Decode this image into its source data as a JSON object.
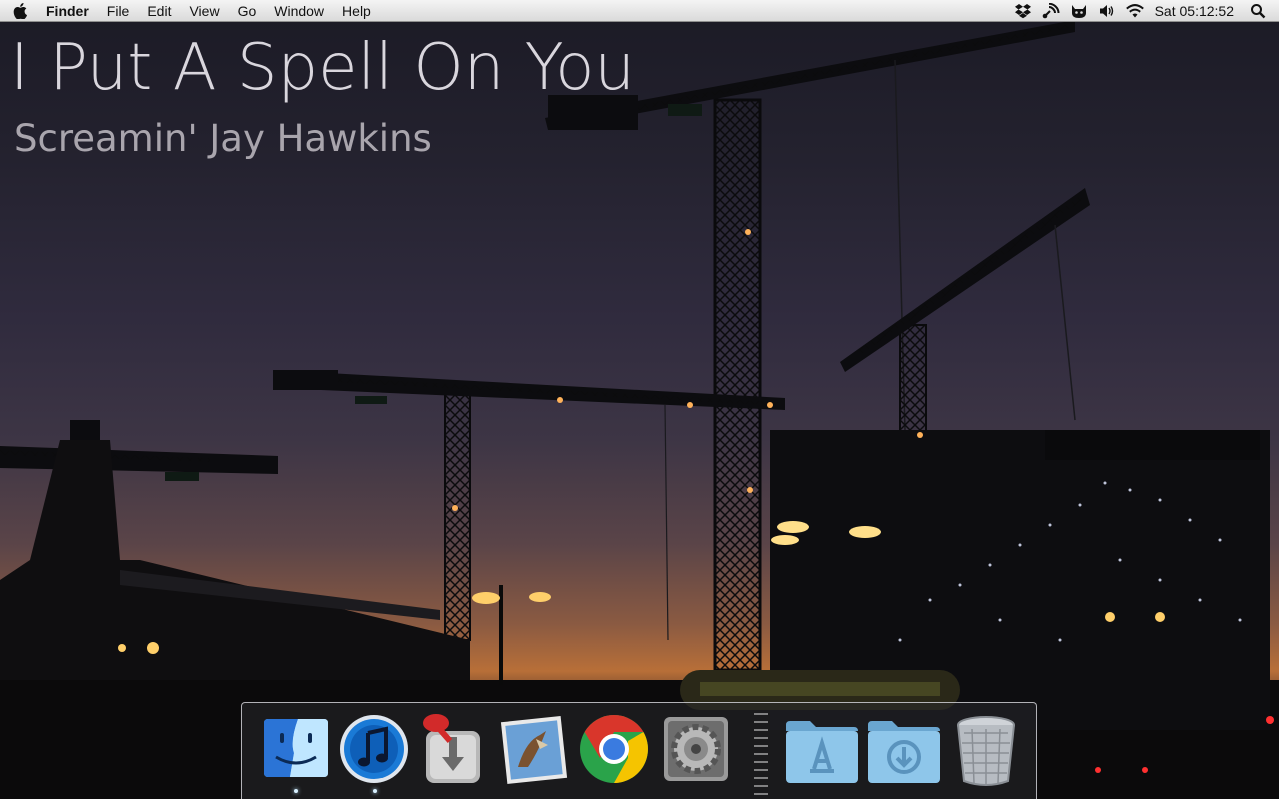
{
  "menubar": {
    "app_name": "Finder",
    "menus": [
      "File",
      "Edit",
      "View",
      "Go",
      "Window",
      "Help"
    ],
    "status_icons": [
      "dropbox-icon",
      "satellite-icon",
      "cat-icon",
      "volume-icon",
      "wifi-icon"
    ],
    "clock": "Sat 05:12:52"
  },
  "now_playing": {
    "title": "I Put A Spell On You",
    "artist": "Screamin' Jay Hawkins"
  },
  "dock": {
    "apps": [
      {
        "name": "Finder",
        "icon": "finder-icon",
        "running": true
      },
      {
        "name": "iTunes",
        "icon": "itunes-icon",
        "running": true
      },
      {
        "name": "Transmission",
        "icon": "transmission-icon",
        "running": false
      },
      {
        "name": "Mail",
        "icon": "mail-icon",
        "running": false
      },
      {
        "name": "Google Chrome",
        "icon": "chrome-icon",
        "running": false
      },
      {
        "name": "System Preferences",
        "icon": "system-preferences-icon",
        "running": false
      }
    ],
    "folders": [
      {
        "name": "Applications",
        "icon": "applications-folder-icon"
      },
      {
        "name": "Downloads",
        "icon": "downloads-folder-icon"
      }
    ],
    "trash": {
      "name": "Trash",
      "icon": "trash-icon"
    }
  },
  "colors": {
    "menubar": "#e6e6e6",
    "title_text": "#d9d6dd",
    "artist_text": "#a9a5ad",
    "sky_top": "#1b1a25",
    "horizon": "#b86f38"
  }
}
